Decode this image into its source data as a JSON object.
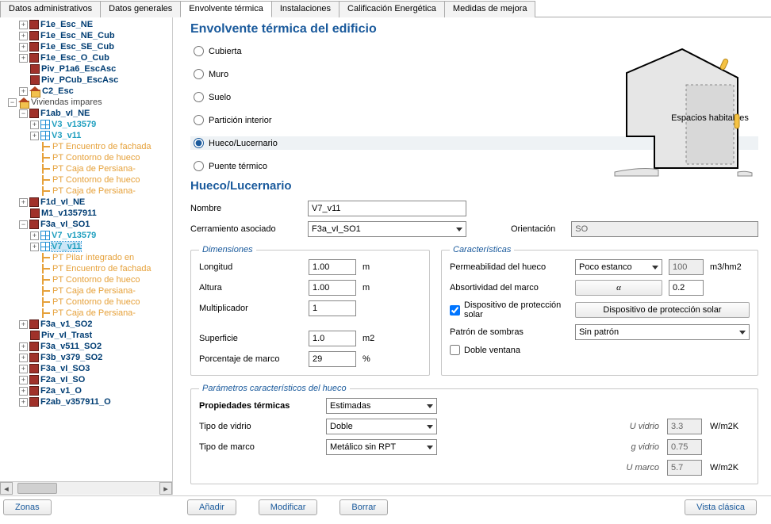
{
  "tabs": {
    "t0": "Datos administrativos",
    "t1": "Datos generales",
    "t2": "Envolvente térmica",
    "t3": "Instalaciones",
    "t4": "Calificación Energética",
    "t5": "Medidas de mejora"
  },
  "tree": {
    "n0": "F1e_Esc_NE",
    "n1": "F1e_Esc_NE_Cub",
    "n2": "F1e_Esc_SE_Cub",
    "n3": "F1e_Esc_O_Cub",
    "n4": "Piv_P1a6_EscAsc",
    "n5": "Piv_PCub_EscAsc",
    "n6": "C2_Esc",
    "n7": "Viviendas impares",
    "n8": "F1ab_vI_NE",
    "n9": "V3_v13579",
    "n10": "V3_v11",
    "n11": "PT Encuentro de fachada",
    "n12": "PT Contorno de hueco",
    "n13": "PT Caja de Persiana-",
    "n14": "PT Contorno de hueco",
    "n15": "PT Caja de Persiana-",
    "n16": "F1d_vI_NE",
    "n17": "M1_v1357911",
    "n18": "F3a_vI_SO1",
    "n19": "V7_v13579",
    "n20": "V7_v11",
    "n21": "PT Pilar integrado en",
    "n22": "PT Encuentro de fachada",
    "n23": "PT Contorno de hueco",
    "n24": "PT Caja de Persiana-",
    "n25": "PT Contorno de hueco",
    "n26": "PT Caja de Persiana-",
    "n27": "F3a_v1_SO2",
    "n28": "Piv_vI_Trast",
    "n29": "F3a_v511_SO2",
    "n30": "F3b_v379_SO2",
    "n31": "F3a_vI_SO3",
    "n32": "F2a_vI_SO",
    "n33": "F2a_v1_O",
    "n34": "F2ab_v357911_O"
  },
  "zonasBtn": "Zonas",
  "heading": "Envolvente térmica del edificio",
  "radios": {
    "r0": "Cubierta",
    "r1": "Muro",
    "r2": "Suelo",
    "r3": "Partición interior",
    "r4": "Hueco/Lucernario",
    "r5": "Puente térmico"
  },
  "h2": "Hueco/Lucernario",
  "labels": {
    "nombre": "Nombre",
    "cerr": "Cerramiento asociado",
    "orient": "Orientación",
    "long": "Longitud",
    "alt": "Altura",
    "mult": "Multiplicador",
    "sup": "Superficie",
    "pctMarco": "Porcentaje de marco",
    "perm": "Permeabilidad del hueco",
    "abs": "Absortividad del marco",
    "disp": "Dispositivo de protección solar",
    "patron": "Patrón de sombras",
    "doble": "Doble ventana",
    "prop": "Propiedades térmicas",
    "vidrio": "Tipo de vidrio",
    "marco": "Tipo de marco",
    "uvidrio": "U vidrio",
    "gvidrio": "g vidrio",
    "umarco": "U marco",
    "dimLegend": "Dimensiones",
    "carLegend": "Características",
    "paramLegend": "Parámetros característicos del hueco",
    "diagLabel": "Espacios habitables"
  },
  "values": {
    "nombre": "V7_v11",
    "cerr": "F3a_vI_SO1",
    "orient": "SO",
    "long": "1.00",
    "alt": "1.00",
    "mult": "1",
    "sup": "1.0",
    "pctMarco": "29",
    "perm": "Poco estanco",
    "permVal": "100",
    "abs": "0.2",
    "patron": "Sin patrón",
    "prop": "Estimadas",
    "vidrio": "Doble",
    "marco": "Metálico sin RPT",
    "uvidrio": "3.3",
    "gvidrio": "0.75",
    "umarco": "5.7",
    "alpha": "α",
    "dispBtn": "Dispositivo de protección solar"
  },
  "units": {
    "m": "m",
    "m2": "m2",
    "pct": "%",
    "m3hm2": "m3/hm2",
    "wm2k": "W/m2K"
  },
  "actions": {
    "anadir": "Añadir",
    "modificar": "Modificar",
    "borrar": "Borrar",
    "vista": "Vista clásica"
  }
}
